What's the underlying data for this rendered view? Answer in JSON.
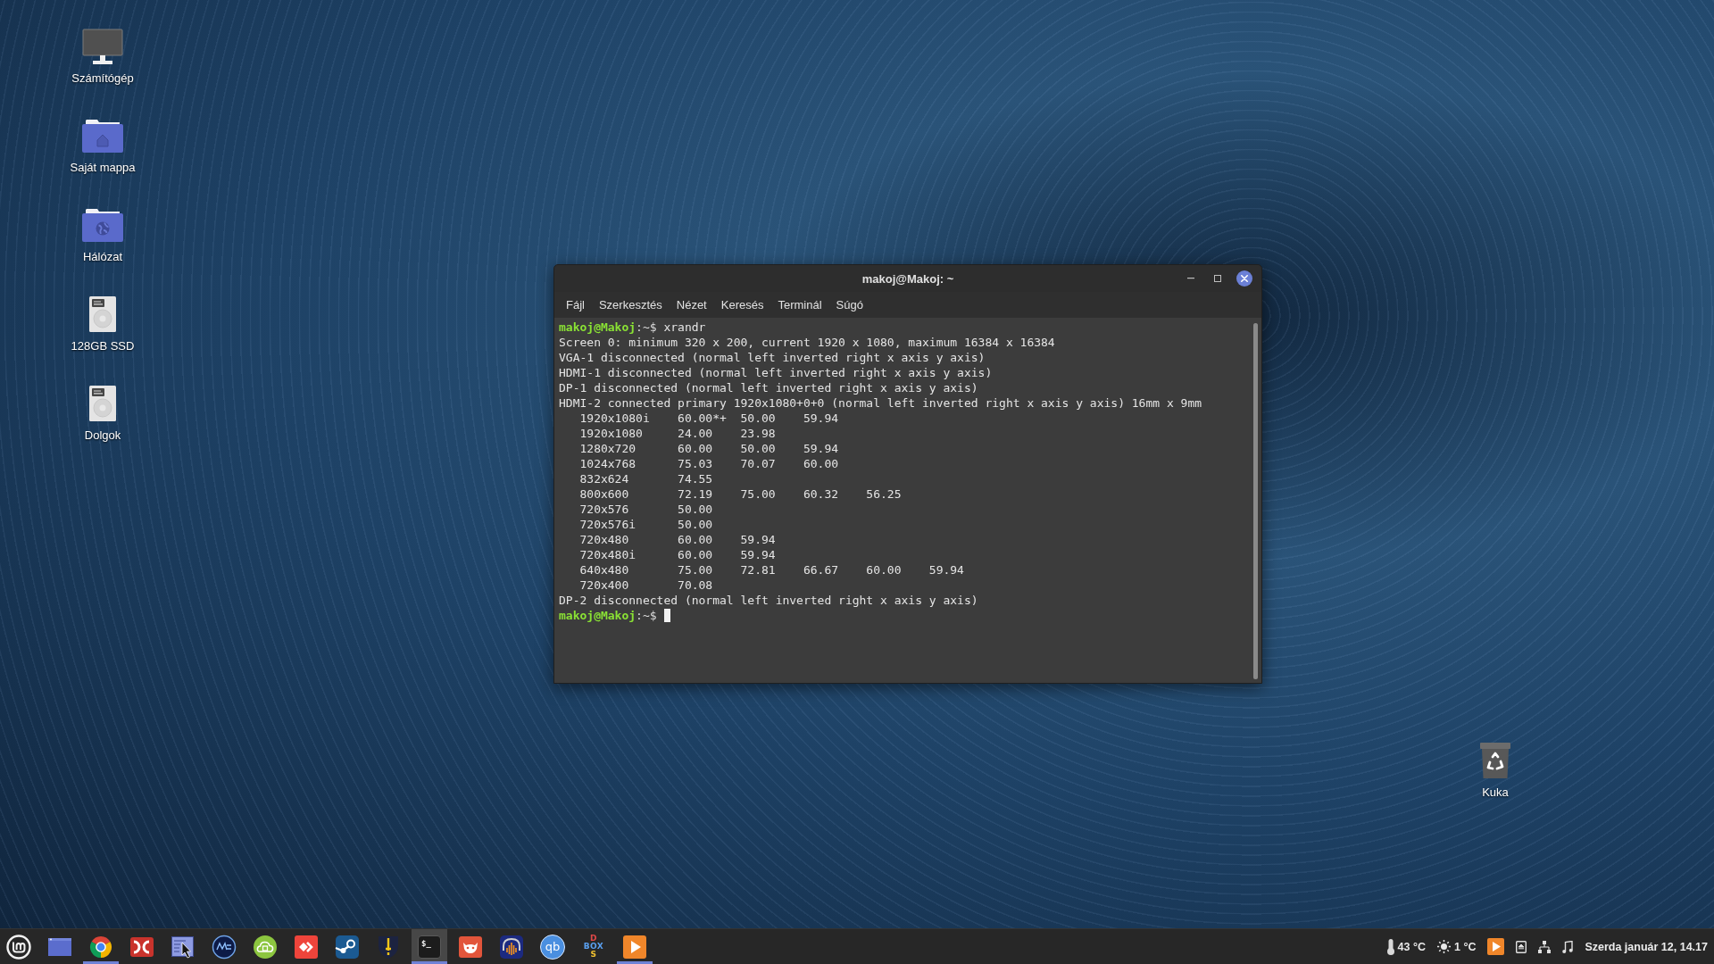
{
  "desktop_icons": [
    {
      "kind": "computer",
      "label": "Számítógép"
    },
    {
      "kind": "home",
      "label": "Saját mappa"
    },
    {
      "kind": "network",
      "label": "Hálózat"
    },
    {
      "kind": "drive",
      "label": "128GB SSD"
    },
    {
      "kind": "drive",
      "label": "Dolgok"
    }
  ],
  "trash": {
    "label": "Kuka"
  },
  "terminal": {
    "title": "makoj@Makoj: ~",
    "menu": [
      "Fájl",
      "Szerkesztés",
      "Nézet",
      "Keresés",
      "Terminál",
      "Súgó"
    ],
    "lines": [
      {
        "kind": "prompt",
        "user": "makoj@Makoj",
        "prompt": ":~$",
        "command": "xrandr",
        "cursor": false
      },
      {
        "kind": "output",
        "text": "Screen 0: minimum 320 x 200, current 1920 x 1080, maximum 16384 x 16384"
      },
      {
        "kind": "output",
        "text": "VGA-1 disconnected (normal left inverted right x axis y axis)"
      },
      {
        "kind": "output",
        "text": "HDMI-1 disconnected (normal left inverted right x axis y axis)"
      },
      {
        "kind": "output",
        "text": "DP-1 disconnected (normal left inverted right x axis y axis)"
      },
      {
        "kind": "output",
        "text": "HDMI-2 connected primary 1920x1080+0+0 (normal left inverted right x axis y axis) 16mm x 9mm"
      },
      {
        "kind": "output",
        "text": "   1920x1080i    60.00*+  50.00    59.94"
      },
      {
        "kind": "output",
        "text": "   1920x1080     24.00    23.98"
      },
      {
        "kind": "output",
        "text": "   1280x720      60.00    50.00    59.94"
      },
      {
        "kind": "output",
        "text": "   1024x768      75.03    70.07    60.00"
      },
      {
        "kind": "output",
        "text": "   832x624       74.55"
      },
      {
        "kind": "output",
        "text": "   800x600       72.19    75.00    60.32    56.25"
      },
      {
        "kind": "output",
        "text": "   720x576       50.00"
      },
      {
        "kind": "output",
        "text": "   720x576i      50.00"
      },
      {
        "kind": "output",
        "text": "   720x480       60.00    59.94"
      },
      {
        "kind": "output",
        "text": "   720x480i      60.00    59.94"
      },
      {
        "kind": "output",
        "text": "   640x480       75.00    72.81    66.67    60.00    59.94"
      },
      {
        "kind": "output",
        "text": "   720x400       70.08"
      },
      {
        "kind": "output",
        "text": "DP-2 disconnected (normal left inverted right x axis y axis)"
      },
      {
        "kind": "prompt",
        "user": "makoj@Makoj",
        "prompt": ":~$",
        "cursor": true
      }
    ]
  },
  "taskbar": {
    "items": [
      {
        "kind": "menu",
        "running": false,
        "selected": false
      },
      {
        "kind": "files",
        "running": false,
        "selected": false
      },
      {
        "kind": "browser",
        "running": true,
        "selected": false
      },
      {
        "kind": "commander",
        "running": false,
        "selected": false
      },
      {
        "kind": "screenshot",
        "running": false,
        "selected": false
      },
      {
        "kind": "mc",
        "running": false,
        "selected": false
      },
      {
        "kind": "cloud",
        "running": false,
        "selected": false
      },
      {
        "kind": "remote",
        "running": false,
        "selected": false
      },
      {
        "kind": "steam",
        "running": false,
        "selected": false
      },
      {
        "kind": "shield",
        "running": false,
        "selected": false
      },
      {
        "kind": "terminal",
        "glyph": "$_",
        "running": true,
        "selected": true
      },
      {
        "kind": "paint",
        "running": false,
        "selected": false
      },
      {
        "kind": "audio",
        "running": false,
        "selected": false
      },
      {
        "kind": "torrent",
        "glyph": "qb",
        "running": false,
        "selected": false
      },
      {
        "kind": "dosbox",
        "glyph_rows": [
          "D",
          "BOX",
          "S"
        ],
        "running": false,
        "selected": false
      },
      {
        "kind": "player",
        "running": true,
        "selected": false
      }
    ],
    "tray": {
      "cpu_temp": "43 °C",
      "weather": "1 °C",
      "clock": "Szerda január 12, 14.17"
    }
  }
}
